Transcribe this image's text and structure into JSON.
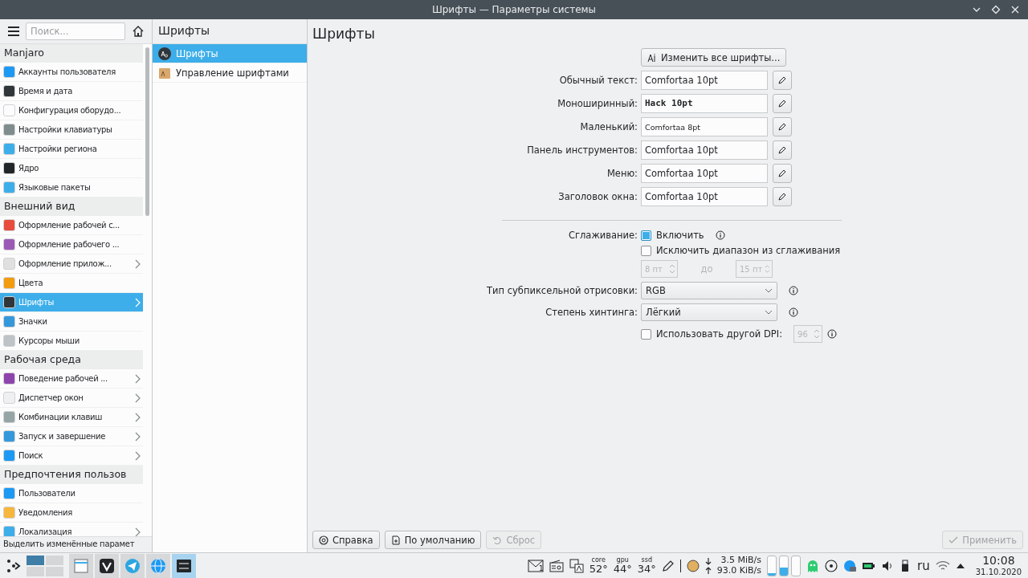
{
  "window": {
    "title": "Шрифты — Параметры системы"
  },
  "sidebar": {
    "search": {
      "placeholder": "Поиск..."
    },
    "groups": [
      {
        "heading": "Manjaro",
        "items": [
          {
            "label": "Аккаунты пользователя",
            "selected": false,
            "has_children": false
          },
          {
            "label": "Время и дата",
            "selected": false,
            "has_children": false
          },
          {
            "label": "Конфигурация оборудо...",
            "selected": false,
            "has_children": false
          },
          {
            "label": "Настройки клавиатуры",
            "selected": false,
            "has_children": false
          },
          {
            "label": "Настройки региона",
            "selected": false,
            "has_children": false
          },
          {
            "label": "Ядро",
            "selected": false,
            "has_children": false
          },
          {
            "label": "Языковые пакеты",
            "selected": false,
            "has_children": false
          }
        ]
      },
      {
        "heading": "Внешний вид",
        "items": [
          {
            "label": "Оформление рабочей с...",
            "selected": false,
            "has_children": false
          },
          {
            "label": "Оформление рабочего ...",
            "selected": false,
            "has_children": false
          },
          {
            "label": "Оформление прилож...",
            "selected": false,
            "has_children": true
          },
          {
            "label": "Цвета",
            "selected": false,
            "has_children": false
          },
          {
            "label": "Шрифты",
            "selected": true,
            "has_children": true
          },
          {
            "label": "Значки",
            "selected": false,
            "has_children": false
          },
          {
            "label": "Курсоры мыши",
            "selected": false,
            "has_children": false
          }
        ]
      },
      {
        "heading": "Рабочая среда",
        "items": [
          {
            "label": "Поведение рабочей ...",
            "selected": false,
            "has_children": true
          },
          {
            "label": "Диспетчер окон",
            "selected": false,
            "has_children": true
          },
          {
            "label": "Комбинации клавиш",
            "selected": false,
            "has_children": true
          },
          {
            "label": "Запуск и завершение",
            "selected": false,
            "has_children": true
          },
          {
            "label": "Поиск",
            "selected": false,
            "has_children": true
          }
        ]
      },
      {
        "heading": "Предпочтения пользов",
        "items": [
          {
            "label": "Пользователи",
            "selected": false,
            "has_children": false
          },
          {
            "label": "Уведомления",
            "selected": false,
            "has_children": false
          },
          {
            "label": "Локализация",
            "selected": false,
            "has_children": true
          }
        ]
      }
    ],
    "footer": "Выделить изменённые парамет"
  },
  "subpanel": {
    "title": "Шрифты",
    "items": [
      {
        "label": "Шрифты",
        "selected": true
      },
      {
        "label": "Управление шрифтами",
        "selected": false
      }
    ]
  },
  "content": {
    "title": "Шрифты",
    "change_all_button": "Изменить все шрифты...",
    "font_rows": [
      {
        "label": "Обычный текст:",
        "value": "Comfortaa 10pt",
        "kind": "normal"
      },
      {
        "label": "Моноширинный:",
        "value": "Hack 10pt",
        "kind": "mono"
      },
      {
        "label": "Маленький:",
        "value": "Comfortaa 8pt",
        "kind": "small"
      },
      {
        "label": "Панель инструментов:",
        "value": "Comfortaa 10pt",
        "kind": "normal"
      },
      {
        "label": "Меню:",
        "value": "Comfortaa 10pt",
        "kind": "normal"
      },
      {
        "label": "Заголовок окна:",
        "value": "Comfortaa 10pt",
        "kind": "normal"
      }
    ],
    "antialiasing": {
      "label": "Сглаживание:",
      "enable": {
        "label": "Включить",
        "checked": true
      },
      "exclude": {
        "label": "Исключить диапазон из сглаживания",
        "checked": false
      },
      "range": {
        "from": "8 пт",
        "separator": "до",
        "to": "15 пт",
        "disabled": true
      }
    },
    "subpixel": {
      "label": "Тип субпиксельной отрисовки:",
      "value": "RGB"
    },
    "hinting": {
      "label": "Степень хинтинга:",
      "value": "Лёгкий"
    },
    "dpi": {
      "label": "Использовать другой DPI:",
      "checked": false,
      "value": "96",
      "disabled": true
    }
  },
  "buttons": [
    {
      "label": "Справка",
      "disabled": false,
      "kind": "help"
    },
    {
      "label": "По умолчанию",
      "disabled": false,
      "kind": "defaults"
    },
    {
      "label": "Сброс",
      "disabled": true,
      "kind": "reset"
    },
    {
      "label": "Применить",
      "disabled": true,
      "kind": "apply"
    }
  ],
  "taskbar": {
    "mail_count": "1",
    "sensors": [
      {
        "label": "core",
        "value": "52°"
      },
      {
        "label": "gpu",
        "value": "44°"
      },
      {
        "label": "ssd",
        "value": "34°"
      }
    ],
    "net_down": "3.5 MiB/s",
    "net_up": "93.0 KiB/s",
    "meters": [
      {
        "level": 0.12
      },
      {
        "level": 0.38
      },
      {
        "level": 0
      }
    ],
    "keyboard_layout": "ru",
    "time": "10:08",
    "date": "31.10.2020"
  }
}
